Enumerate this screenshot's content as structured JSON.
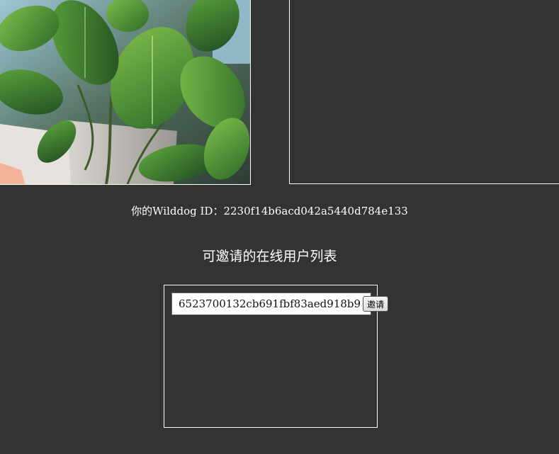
{
  "local_video": {
    "label": ""
  },
  "remote_video": {
    "label": ""
  },
  "identity": {
    "prefix": "你的Wilddog ID：",
    "id": "2230f14b6acd042a5440d784e133"
  },
  "online_users": {
    "title": "可邀请的在线用户列表",
    "items": [
      {
        "id": "6523700132cb691fbf83aed918b9",
        "invite_label": "邀请"
      }
    ]
  },
  "colors": {
    "background": "#333333",
    "border": "#ffffff",
    "text": "#ffffff"
  }
}
